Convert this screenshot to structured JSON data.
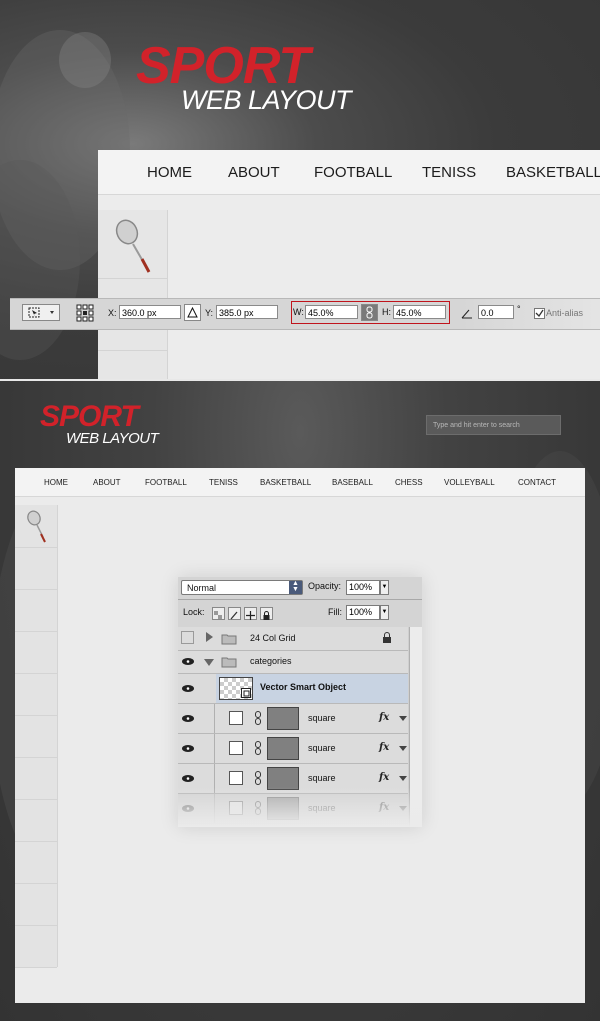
{
  "brand": {
    "sport": "SPORT",
    "web_layout": "WEB LAYOUT"
  },
  "nav_top": [
    "HOME",
    "ABOUT",
    "FOOTBALL",
    "TENISS",
    "BASKETBALL"
  ],
  "nav_bottom": [
    "HOME",
    "ABOUT",
    "FOOTBALL",
    "TENISS",
    "BASKETBALL",
    "BASEBALL",
    "CHESS",
    "VOLLEYBALL",
    "CONTACT"
  ],
  "search": {
    "placeholder": "Type and hit enter to search"
  },
  "options_bar": {
    "x_label": "X:",
    "x_value": "360.0 px",
    "y_label": "Y:",
    "y_value": "385.0 px",
    "w_label": "W:",
    "w_value": "45.0%",
    "h_label": "H:",
    "h_value": "45.0%",
    "angle_value": "0.0",
    "degree": "°",
    "anti_alias": "Anti-alias",
    "highlight_color": "#c0141c"
  },
  "layers_panel": {
    "blend_mode": "Normal",
    "opacity_label": "Opacity:",
    "opacity_value": "100%",
    "lock_label": "Lock:",
    "fill_label": "Fill:",
    "fill_value": "100%",
    "layers": [
      {
        "name": "24 Col Grid",
        "kind": "group-collapsed",
        "visible": false,
        "locked": true
      },
      {
        "name": "categories",
        "kind": "group-expanded",
        "visible": true
      },
      {
        "name": "Vector Smart Object",
        "kind": "smart-object",
        "visible": true,
        "selected": true
      },
      {
        "name": "square",
        "kind": "shape",
        "visible": true,
        "fx": "fx"
      },
      {
        "name": "square",
        "kind": "shape",
        "visible": true,
        "fx": "fx"
      },
      {
        "name": "square",
        "kind": "shape",
        "visible": true,
        "fx": "fx"
      },
      {
        "name": "square",
        "kind": "shape",
        "visible": true,
        "fx": "fx"
      }
    ]
  },
  "colors": {
    "brand_red": "#d2222a",
    "panel_bg": "#3a3a3a"
  }
}
